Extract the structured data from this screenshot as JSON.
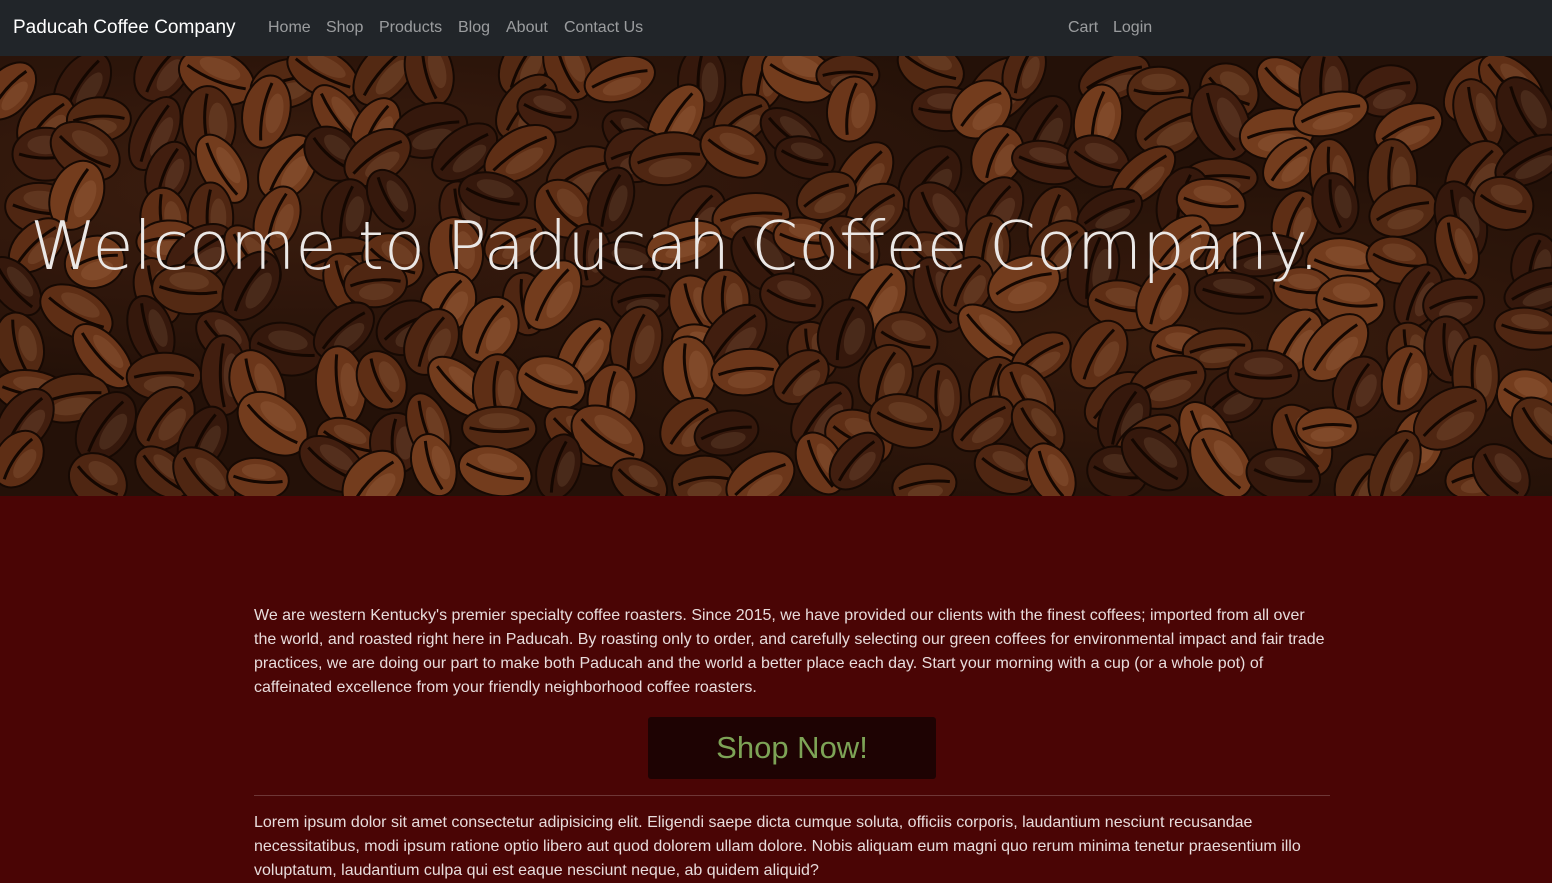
{
  "navbar": {
    "brand": "Paducah Coffee Company",
    "links": [
      {
        "label": "Home"
      },
      {
        "label": "Shop"
      },
      {
        "label": "Products"
      },
      {
        "label": "Blog"
      },
      {
        "label": "About"
      },
      {
        "label": "Contact Us"
      }
    ],
    "right_links": [
      {
        "label": "Cart"
      },
      {
        "label": "Login"
      }
    ]
  },
  "hero": {
    "title": "Welcome to Paducah Coffee Company.",
    "image": "coffee-beans-background"
  },
  "main": {
    "intro": "We are western Kentucky's premier specialty coffee roasters. Since 2015, we have provided our clients with the finest coffees; imported from all over the world, and roasted right here in Paducah. By roasting only to order, and carefully selecting our green coffees for environmental impact and fair trade practices, we are doing our part to make both Paducah and the world a better place each day. Start your morning with a cup (or a whole pot) of caffeinated excellence from your friendly neighborhood coffee roasters.",
    "shop_button_label": "Shop Now!",
    "lorem": "Lorem ipsum dolor sit amet consectetur adipisicing elit. Eligendi saepe dicta cumque soluta, officiis corporis, laudantium nesciunt recusandae necessitatibus, modi ipsum ratione optio libero aut quod dolorem ullam dolore. Nobis aliquam eum magni quo rerum minima tenetur praesentium illo voluptatum, laudantium culpa qui est eaque nesciunt neque, ab quidem aliquid?"
  },
  "colors": {
    "navbar_bg": "#212529",
    "content_bg": "#4a0505",
    "button_bg": "#1e0303",
    "button_text": "#7da356"
  }
}
